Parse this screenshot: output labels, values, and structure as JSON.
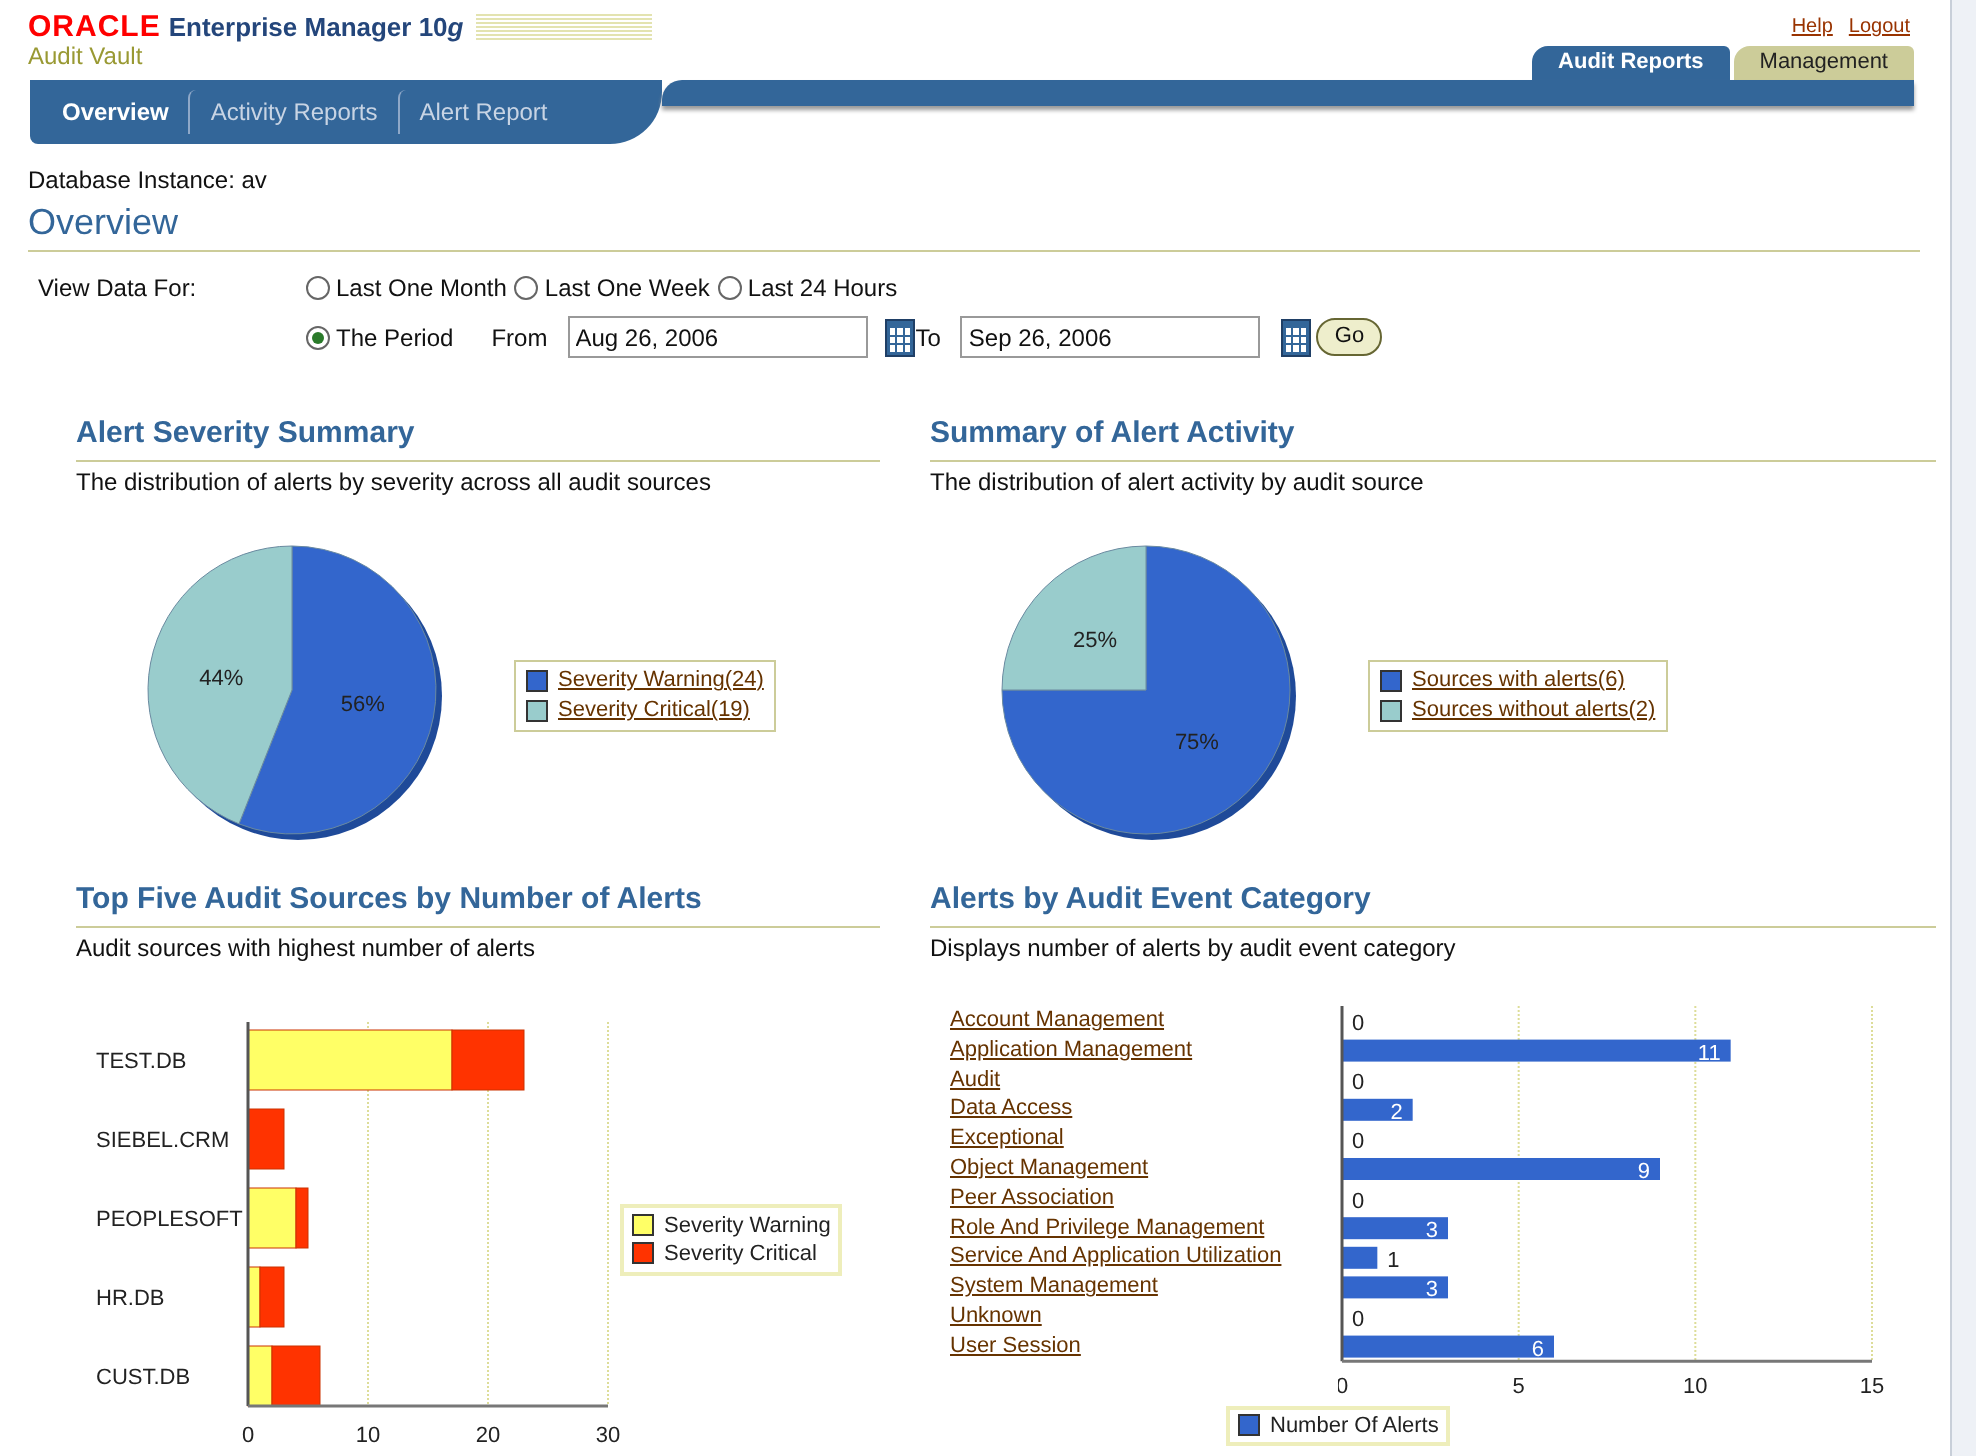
{
  "header": {
    "logo": "ORACLE",
    "product": "Enterprise Manager 10",
    "product_suffix": "g",
    "subtitle": "Audit Vault",
    "links": [
      "Help",
      "Logout"
    ],
    "tabs": [
      {
        "label": "Audit Reports",
        "selected": true
      },
      {
        "label": "Management",
        "selected": false
      }
    ]
  },
  "subtabs": [
    {
      "label": "Overview",
      "selected": true
    },
    {
      "label": "Activity Reports",
      "selected": false
    },
    {
      "label": "Alert Report",
      "selected": false
    }
  ],
  "database_instance": "Database Instance: av",
  "page_title": "Overview",
  "filter": {
    "label": "View Data For:",
    "options": [
      {
        "label": "Last One Month",
        "selected": false
      },
      {
        "label": "Last One Week",
        "selected": false
      },
      {
        "label": "Last 24 Hours",
        "selected": false
      },
      {
        "label": "The Period",
        "selected": true
      }
    ],
    "from_label": "From",
    "from_value": "Aug 26, 2006",
    "to_label": "To",
    "to_value": "Sep 26, 2006",
    "go": "Go"
  },
  "sections": [
    {
      "title": "Alert Severity Summary",
      "description": "The distribution of alerts by severity across all audit sources",
      "chart_data": {
        "type": "pie",
        "categories": [
          "Severity Warning(24)",
          "Severity Critical(19)"
        ],
        "values": [
          56,
          44
        ],
        "colors": [
          "#3366cc",
          "#99cccc"
        ],
        "value_labels": [
          "56%",
          "44%"
        ],
        "legend": "right"
      }
    },
    {
      "title": "Summary of Alert Activity",
      "description": "The distribution of alert activity by audit source",
      "chart_data": {
        "type": "pie",
        "categories": [
          "Sources with alerts(6)",
          "Sources without alerts(2)"
        ],
        "values": [
          75,
          25
        ],
        "colors": [
          "#3366cc",
          "#99cccc"
        ],
        "value_labels": [
          "75%",
          "25%"
        ],
        "legend": "right"
      }
    },
    {
      "title": "Top Five Audit Sources by Number of Alerts",
      "description": "Audit sources with highest number of alerts",
      "chart_data": {
        "type": "bar",
        "orientation": "horizontal",
        "stacked": true,
        "categories": [
          "TEST.DB",
          "SIEBEL.CRM",
          "PEOPLESOFT",
          "HR.DB",
          "CUST.DB"
        ],
        "series": [
          {
            "name": "Severity Warning",
            "color": "#ffff66",
            "values": [
              17,
              0,
              4,
              1,
              2
            ]
          },
          {
            "name": "Severity Critical",
            "color": "#ff3300",
            "values": [
              6,
              3,
              1,
              2,
              4
            ]
          }
        ],
        "xlim": [
          0,
          30
        ],
        "xticks": [
          0,
          10,
          20,
          30
        ],
        "legend": "right"
      }
    },
    {
      "title": "Alerts by Audit Event Category",
      "description": "Displays number of alerts by audit event category",
      "chart_data": {
        "type": "bar",
        "orientation": "horizontal",
        "categories": [
          "Account Management",
          "Application Management",
          "Audit",
          "Data Access",
          "Exceptional",
          "Object Management",
          "Peer Association",
          "Role And Privilege Management",
          "Service And Application Utilization",
          "System Management",
          "Unknown",
          "User Session"
        ],
        "series": [
          {
            "name": "Number Of Alerts",
            "color": "#3366cc",
            "values": [
              0,
              11,
              0,
              2,
              0,
              9,
              0,
              3,
              1,
              3,
              0,
              6
            ]
          }
        ],
        "xlim": [
          0,
          15
        ],
        "xticks": [
          0,
          5,
          10,
          15
        ],
        "data_labels": true,
        "legend": "bottom"
      }
    }
  ]
}
